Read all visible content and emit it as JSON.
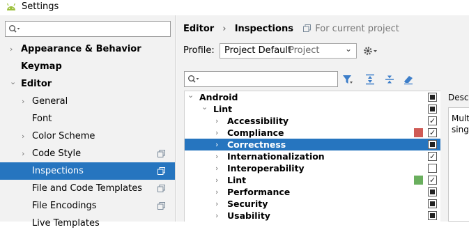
{
  "window": {
    "title": "Settings"
  },
  "left": {
    "search": {
      "placeholder": "",
      "value": ""
    },
    "items": [
      {
        "label": "Appearance & Behavior",
        "arrow": "›",
        "bold": true
      },
      {
        "label": "Keymap",
        "arrow": "",
        "bold": true
      },
      {
        "label": "Editor",
        "arrow": "⌄",
        "bold": true
      },
      {
        "label": "General",
        "arrow": "›",
        "bold": false
      },
      {
        "label": "Font",
        "arrow": "",
        "bold": false
      },
      {
        "label": "Color Scheme",
        "arrow": "›",
        "bold": false
      },
      {
        "label": "Code Style",
        "arrow": "›",
        "bold": false
      },
      {
        "label": "Inspections",
        "arrow": "",
        "bold": false
      },
      {
        "label": "File and Code Templates",
        "arrow": "",
        "bold": false
      },
      {
        "label": "File Encodings",
        "arrow": "",
        "bold": false
      },
      {
        "label": "Live Templates",
        "arrow": "",
        "bold": false
      }
    ]
  },
  "breadcrumb": {
    "part1": "Editor",
    "sep": "›",
    "part2": "Inspections",
    "scope": "For current project"
  },
  "profile": {
    "label": "Profile:",
    "value": "Project Default",
    "scope": "Project"
  },
  "inspections": {
    "search": {
      "value": ""
    },
    "tree": [
      {
        "label": "Android",
        "arrow": "⌄",
        "check": "mixed"
      },
      {
        "label": "Lint",
        "arrow": "⌄",
        "check": "mixed"
      },
      {
        "label": "Accessibility",
        "arrow": "›",
        "check": "checked"
      },
      {
        "label": "Compliance",
        "arrow": "›",
        "check": "checked",
        "severity_color": "#cf5b56"
      },
      {
        "label": "Correctness",
        "arrow": "›",
        "check": "mixed"
      },
      {
        "label": "Internationalization",
        "arrow": "›",
        "check": "checked"
      },
      {
        "label": "Interoperability",
        "arrow": "›",
        "check": "unchecked"
      },
      {
        "label": "Lint",
        "arrow": "›",
        "check": "checked",
        "severity_color": "#6aaf5e"
      },
      {
        "label": "Performance",
        "arrow": "›",
        "check": "mixed"
      },
      {
        "label": "Security",
        "arrow": "›",
        "check": "mixed"
      },
      {
        "label": "Usability",
        "arrow": "›",
        "check": "mixed"
      }
    ]
  },
  "description": {
    "label": "Descr",
    "line1": "Mult",
    "line2": "sing"
  },
  "colors": {
    "selection": "#2675bf",
    "panel": "#f2f2f2"
  }
}
